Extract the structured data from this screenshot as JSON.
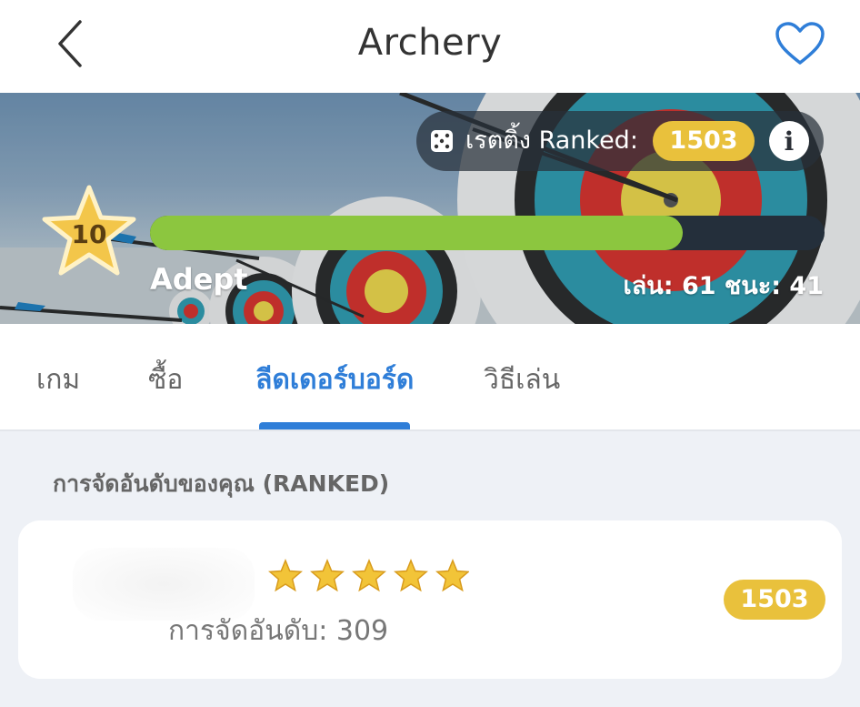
{
  "header": {
    "title": "Archery",
    "back_icon": "chevron-left-icon",
    "favorite_icon": "heart-outline-icon"
  },
  "hero": {
    "rating_label": "เรตติ้ง Ranked:",
    "rating_value": "1503",
    "info_label": "i",
    "level": "10",
    "level_name": "Adept",
    "progress_fraction": 0.79,
    "stats": "เล่น: 61 ชนะ: 41"
  },
  "tabs": [
    {
      "label": "เกม",
      "active": false
    },
    {
      "label": "ซื้อ",
      "active": false
    },
    {
      "label": "ลีดเดอร์บอร์ด",
      "active": true
    },
    {
      "label": "วิธีเล่น",
      "active": false
    }
  ],
  "leaderboard": {
    "section_title": "การจัดอันดับของคุณ (RANKED)",
    "stars": 5,
    "rank_label": "การจัดอันดับ: 309",
    "rating": "1503"
  },
  "colors": {
    "accent": "#2f7ed8",
    "gold": "#e9c13c",
    "progress": "#8cc63f"
  }
}
